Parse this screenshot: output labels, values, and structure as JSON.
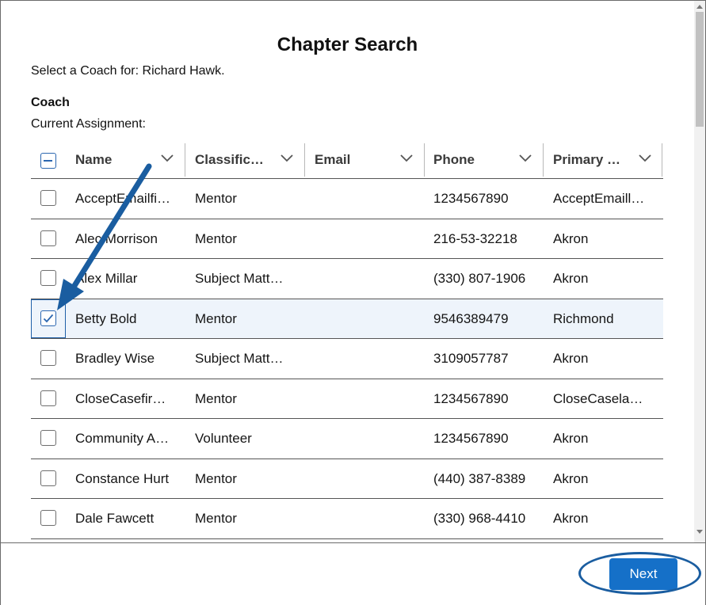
{
  "dialog": {
    "title": "Chapter Search",
    "subtitle": "Select a Coach for: Richard Hawk.",
    "section_label": "Coach",
    "assignment_label": "Current Assignment:"
  },
  "table": {
    "columns": [
      "Name",
      "Classific…",
      "Email",
      "Phone",
      "Primary …"
    ],
    "rows": [
      {
        "name": "AcceptEmailfi…",
        "classification": "Mentor",
        "email": "",
        "phone": "1234567890",
        "primary": "AcceptEmaill…",
        "selected": false
      },
      {
        "name": "Alec Morrison",
        "classification": "Mentor",
        "email": "",
        "phone": "216-53-32218",
        "primary": "Akron",
        "selected": false
      },
      {
        "name": "Alex Millar",
        "classification": "Subject Matt…",
        "email": "",
        "phone": "(330) 807-1906",
        "primary": "Akron",
        "selected": false
      },
      {
        "name": "Betty Bold",
        "classification": "Mentor",
        "email": "",
        "phone": "9546389479",
        "primary": "Richmond",
        "selected": true
      },
      {
        "name": "Bradley Wise",
        "classification": "Subject Matt…",
        "email": "",
        "phone": "3109057787",
        "primary": "Akron",
        "selected": false
      },
      {
        "name": "CloseCasefir…",
        "classification": "Mentor",
        "email": "",
        "phone": "1234567890",
        "primary": "CloseCasela…",
        "selected": false
      },
      {
        "name": "Community A…",
        "classification": "Volunteer",
        "email": "",
        "phone": "1234567890",
        "primary": "Akron",
        "selected": false
      },
      {
        "name": "Constance Hurt",
        "classification": "Mentor",
        "email": "",
        "phone": "(440) 387-8389",
        "primary": "Akron",
        "selected": false
      },
      {
        "name": "Dale Fawcett",
        "classification": "Mentor",
        "email": "",
        "phone": "(330) 968-4410",
        "primary": "Akron",
        "selected": false
      }
    ]
  },
  "footer": {
    "next_label": "Next"
  },
  "colors": {
    "accent": "#1570c8",
    "annotation": "#1a5da0",
    "selected_row": "#eef4fb"
  },
  "icons": {
    "header_checkbox": "indeterminate-checkbox-icon",
    "sort": "chevron-down-icon",
    "check": "checkmark-icon"
  }
}
